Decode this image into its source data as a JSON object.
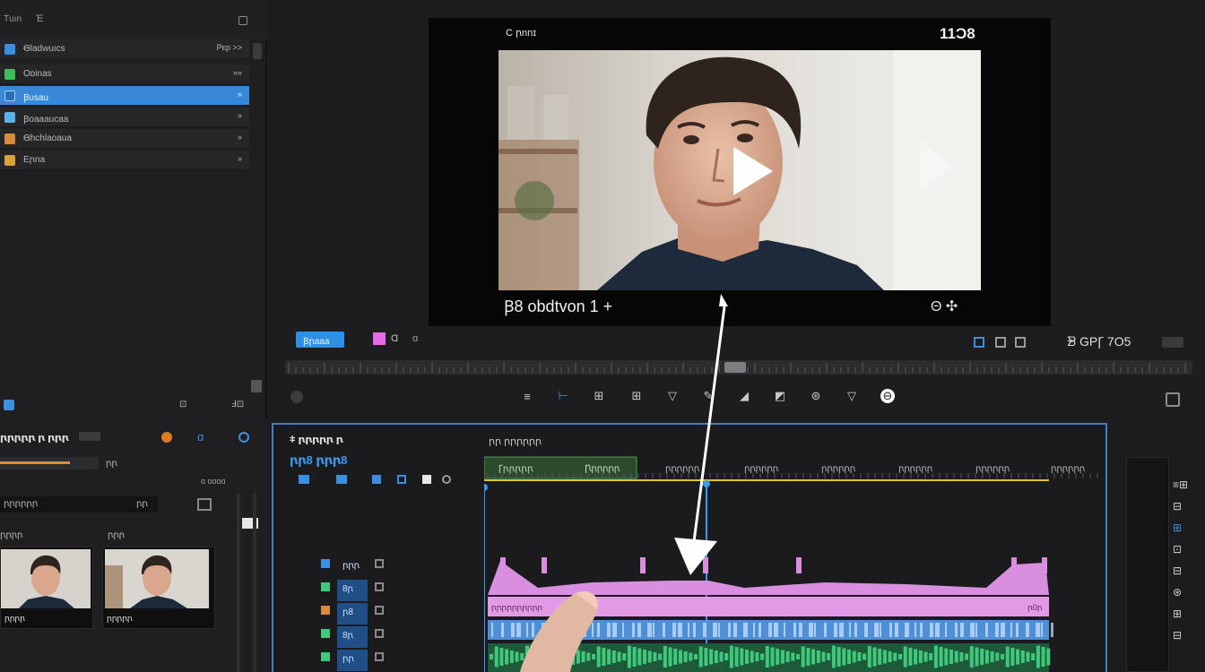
{
  "project": {
    "header_label": "Ṫuın",
    "search_label": "Ἐ",
    "items": [
      {
        "label": "Ꞡladwuıcs",
        "right": "Pᴇp >>",
        "icon_color": "#3a8fe0"
      },
      {
        "label": "Oᴅinas",
        "right": "»»",
        "icon_color": "#3fbf5a"
      },
      {
        "label": "Ꞵᴜsau",
        "right": "»",
        "icon_color": "#3a8fe0"
      },
      {
        "label": "Ꞵoaaaucaa",
        "right": "»",
        "icon_color": "#5ab0e8"
      },
      {
        "label": "Ꞡhchlaoaua",
        "right": "»",
        "icon_color": "#d98a3a"
      },
      {
        "label": "Eꞃna",
        "right": "»",
        "icon_color": "#d9a23a"
      }
    ],
    "footer_left": "⊡",
    "footer_mid": "⊡",
    "footer_right": "Ⅎ⊡"
  },
  "viewer": {
    "top_left": "C ꞃnnɪ",
    "top_right": "11Ͻ8",
    "bottom_left": "Ꞵ8 obdtvon 1 +",
    "bottom_right": "Θ ✣"
  },
  "toolbar": {
    "mark_label": "Ꞵꞃaaa",
    "color_label": "Ɑ",
    "right_label": "ᗾ GPꞄ 7O5",
    "tools": [
      "≡",
      "⊢",
      "⊞",
      "⊞",
      "▽",
      "✎",
      "◢",
      "◩",
      "⊛",
      "▽",
      "⊖"
    ]
  },
  "timeline": {
    "title": "ǂ ꞃꞃꞃꞃꞃ ꞃ",
    "timecode": "ꞃꞃ8 ꞃꞃꞃ8",
    "tab_label": "ꞃꞃ ꞃꞃꞃꞃꞃꞃ",
    "clips": [
      "Ꞅꞃꞃꞃꞃꞃ",
      "Ꞃꞃꞃꞃꞃꞃ",
      "ꞃꞃꞃꞃꞃꞃ",
      "ꞃꞃꞃꞃꞃꞃ",
      "ꞃꞃꞃꞃꞃꞃ",
      "ꞃꞃꞃꞃꞃꞃ",
      "ꞃꞃꞃꞃꞃꞃ",
      "ꞃꞃꞃꞃꞃꞃ"
    ],
    "track_labels": [
      "ꞃꞃꞃ",
      "8ꞃ",
      "ꞃ8",
      "8ꞃ",
      "ꞃꞃ"
    ],
    "pink_label": "ꞃꞃꞃꞃꞃꞃꞃꞃꞃꞃ",
    "pink_end": "ꞃ0ꞃ"
  },
  "bottom_left": {
    "title": "ꞃꞃꞃꞃꞃ ꞃ ꞃꞃꞃ",
    "row1_right": "ꞃꞃ",
    "row2_left": "ꞃꞃꞃꞃꞃꞃ",
    "row3_left": "ꞃꞃꞃꞃ",
    "row3_right": "ꞃꞃꞃ",
    "row4_right": "ꞃꞃ",
    "thumb1_label": "ꞃꞃꞃꞃ",
    "thumb2_label": "ꞃꞃꞃꞃꞃ"
  },
  "right_strip": {
    "items": [
      "ꞃꞃ",
      "ꞃꞃ",
      "ꞃꞃ",
      "ꞃꞃ",
      "ꞃꞃ",
      "ꞃꞃ",
      "ꞃꞃ",
      "ꞃꞃ"
    ]
  },
  "colors": {
    "accent": "#3a87d6",
    "pink": "#e39ae6",
    "blue_track": "#4f8fd6",
    "green_track": "#41c77a",
    "timeline_border": "#3f7fc4"
  }
}
